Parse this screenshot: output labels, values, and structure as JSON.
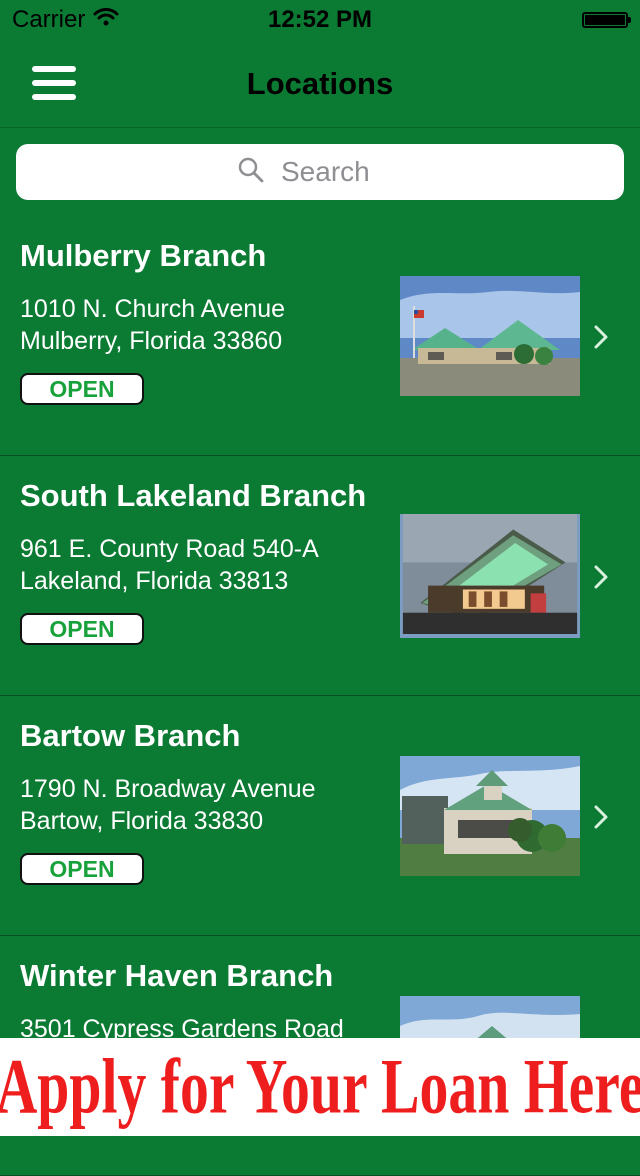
{
  "status_bar": {
    "carrier": "Carrier",
    "time": "12:52 PM",
    "battery_level": 1.0
  },
  "nav": {
    "title": "Locations",
    "menu_icon": "hamburger-menu-icon"
  },
  "search": {
    "placeholder": "Search",
    "icon": "search-icon"
  },
  "locations": [
    {
      "name": "Mulberry Branch",
      "address_line1": "1010 N. Church Avenue",
      "address_line2": "Mulberry, Florida 33860",
      "status": "OPEN"
    },
    {
      "name": "South Lakeland Branch",
      "address_line1": "961 E. County Road 540-A",
      "address_line2": "Lakeland, Florida 33813",
      "status": "OPEN"
    },
    {
      "name": "Bartow Branch",
      "address_line1": "1790 N. Broadway Avenue",
      "address_line2": "Bartow, Florida 33830",
      "status": "OPEN"
    },
    {
      "name": "Winter Haven Branch",
      "address_line1": "3501 Cypress Gardens Road",
      "address_line2": "",
      "status": ""
    }
  ],
  "banner": {
    "text": "Apply for Your Loan Here"
  },
  "colors": {
    "background": "#0b7a33",
    "status_open": "#19a13b",
    "banner_text": "#ef1e1e"
  }
}
